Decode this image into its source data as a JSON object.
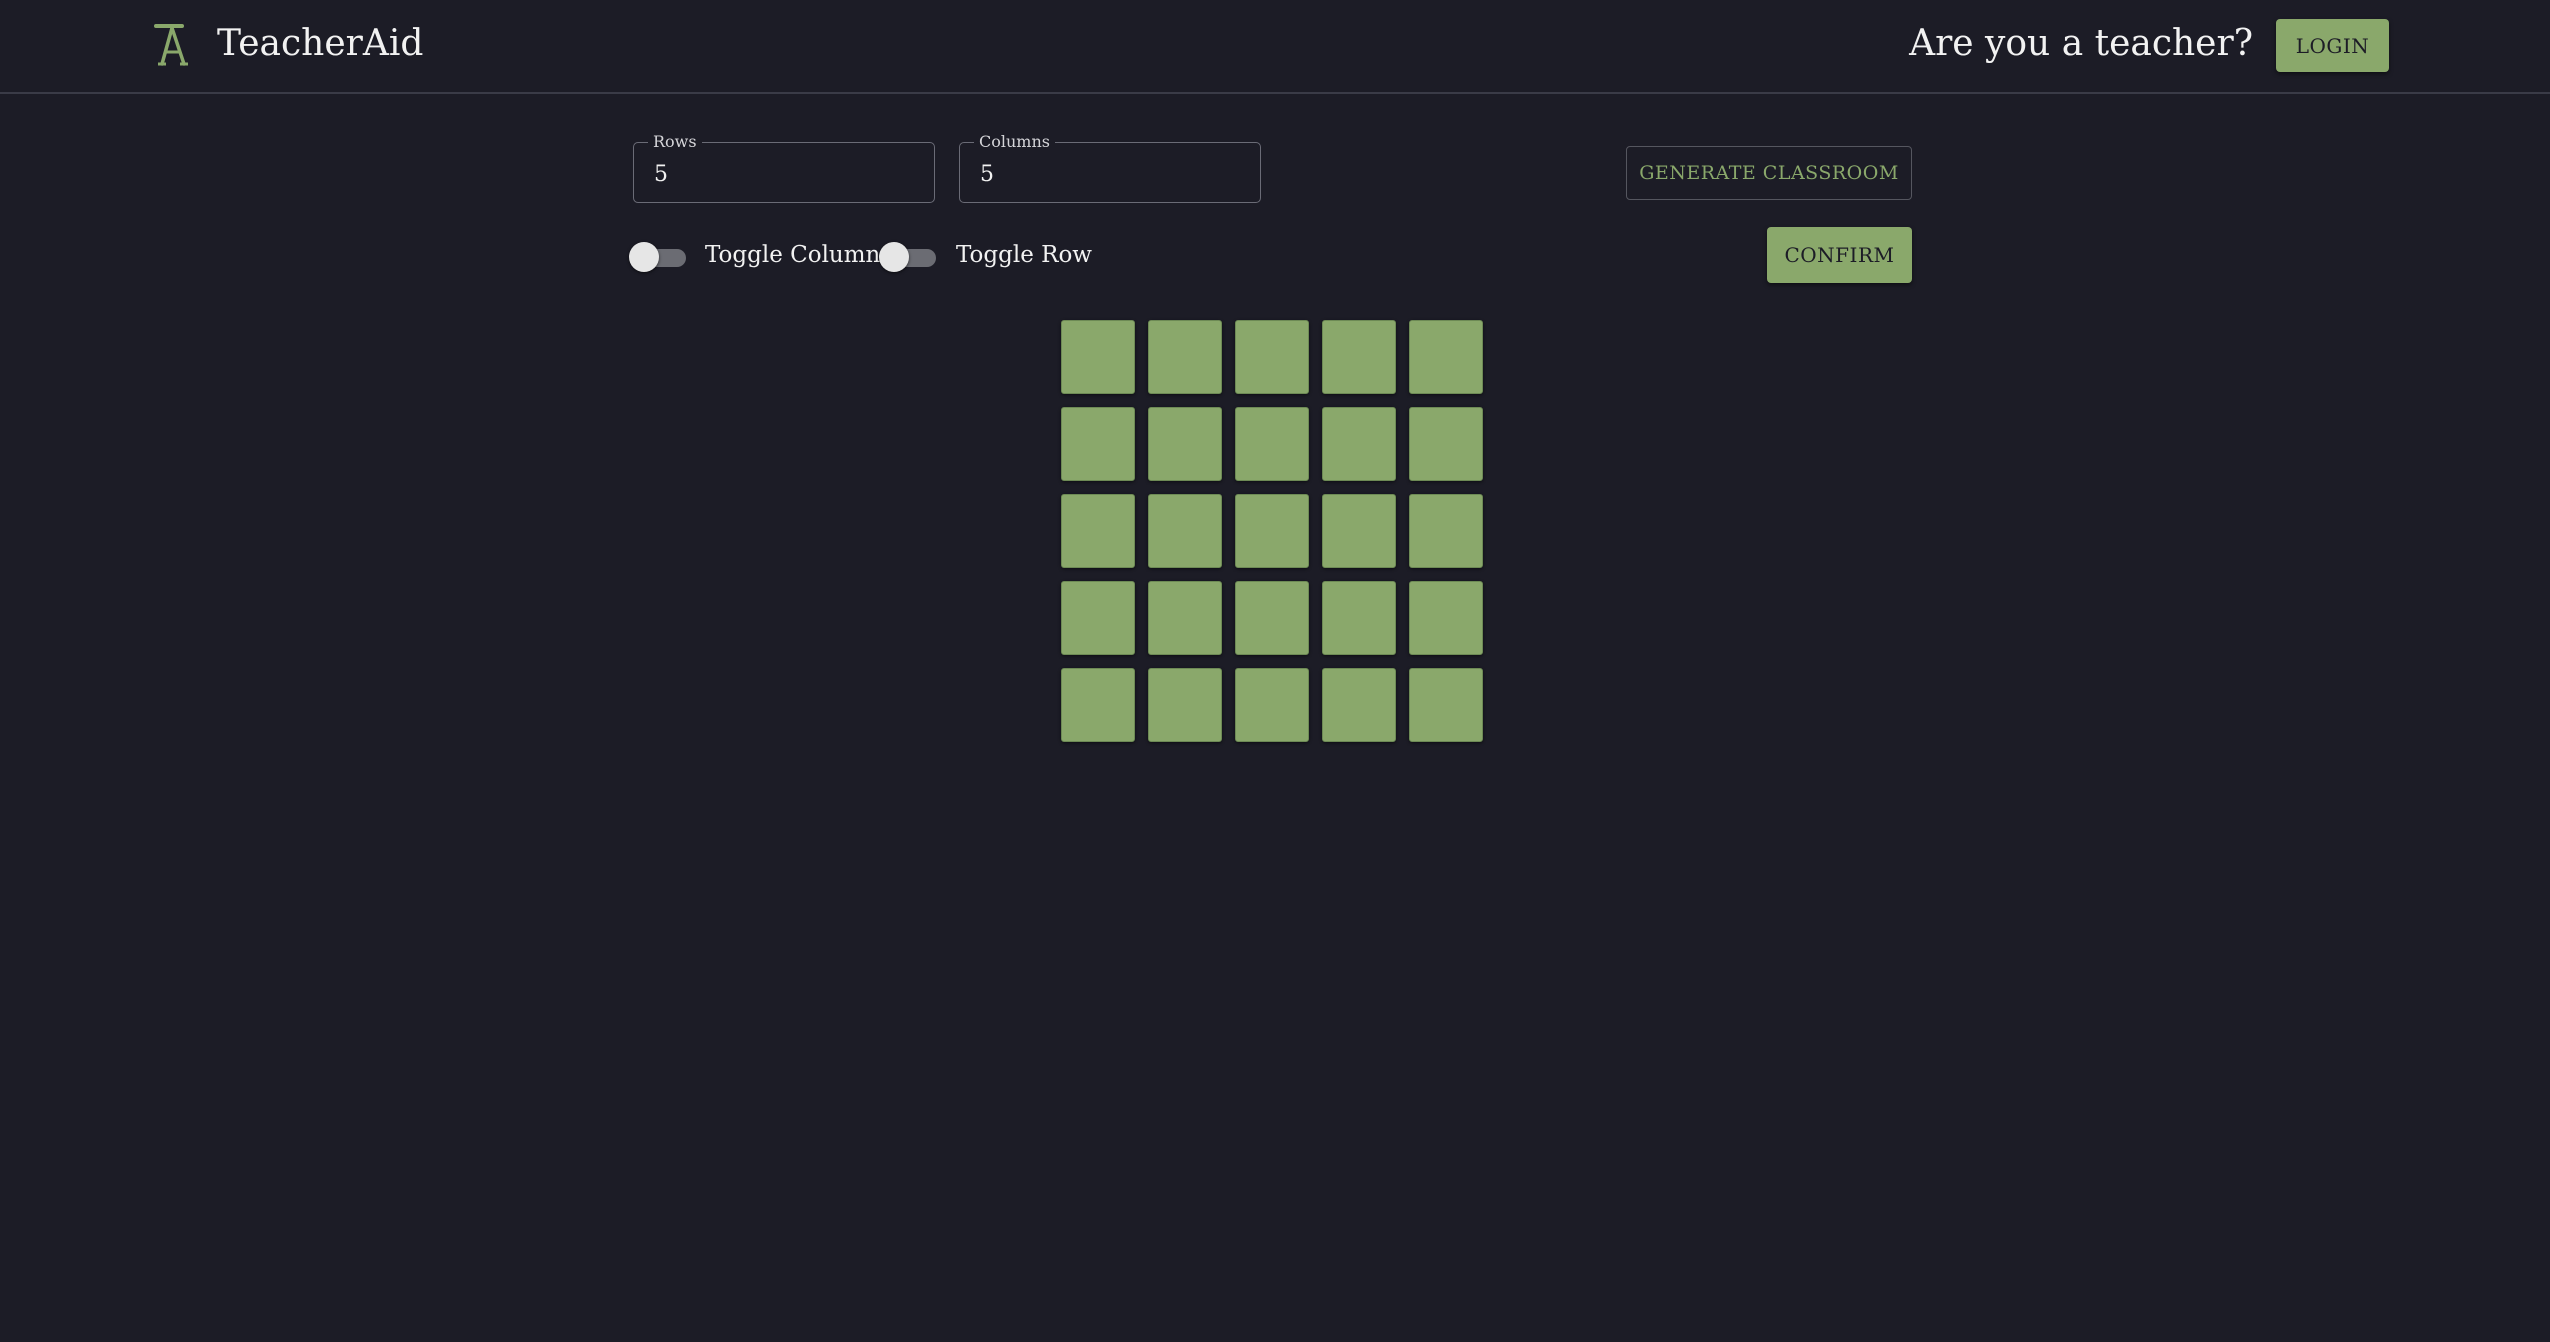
{
  "header": {
    "logo_icon": "teacheraid-logo-icon",
    "title": "TeacherAid",
    "prompt": "Are you a teacher?",
    "login_label": "LOGIN"
  },
  "controls": {
    "rows": {
      "label": "Rows",
      "value": "5"
    },
    "columns": {
      "label": "Columns",
      "value": "5"
    },
    "generate_label": "GENERATE CLASSROOM",
    "toggle_column": {
      "label": "Toggle Column",
      "on": false
    },
    "toggle_row": {
      "label": "Toggle Row",
      "on": false
    },
    "confirm_label": "CONFIRM"
  },
  "grid": {
    "rows": 5,
    "columns": 5
  },
  "colors": {
    "background": "#1c1c26",
    "accent": "#8aa86b",
    "text": "#f2f2f2"
  }
}
